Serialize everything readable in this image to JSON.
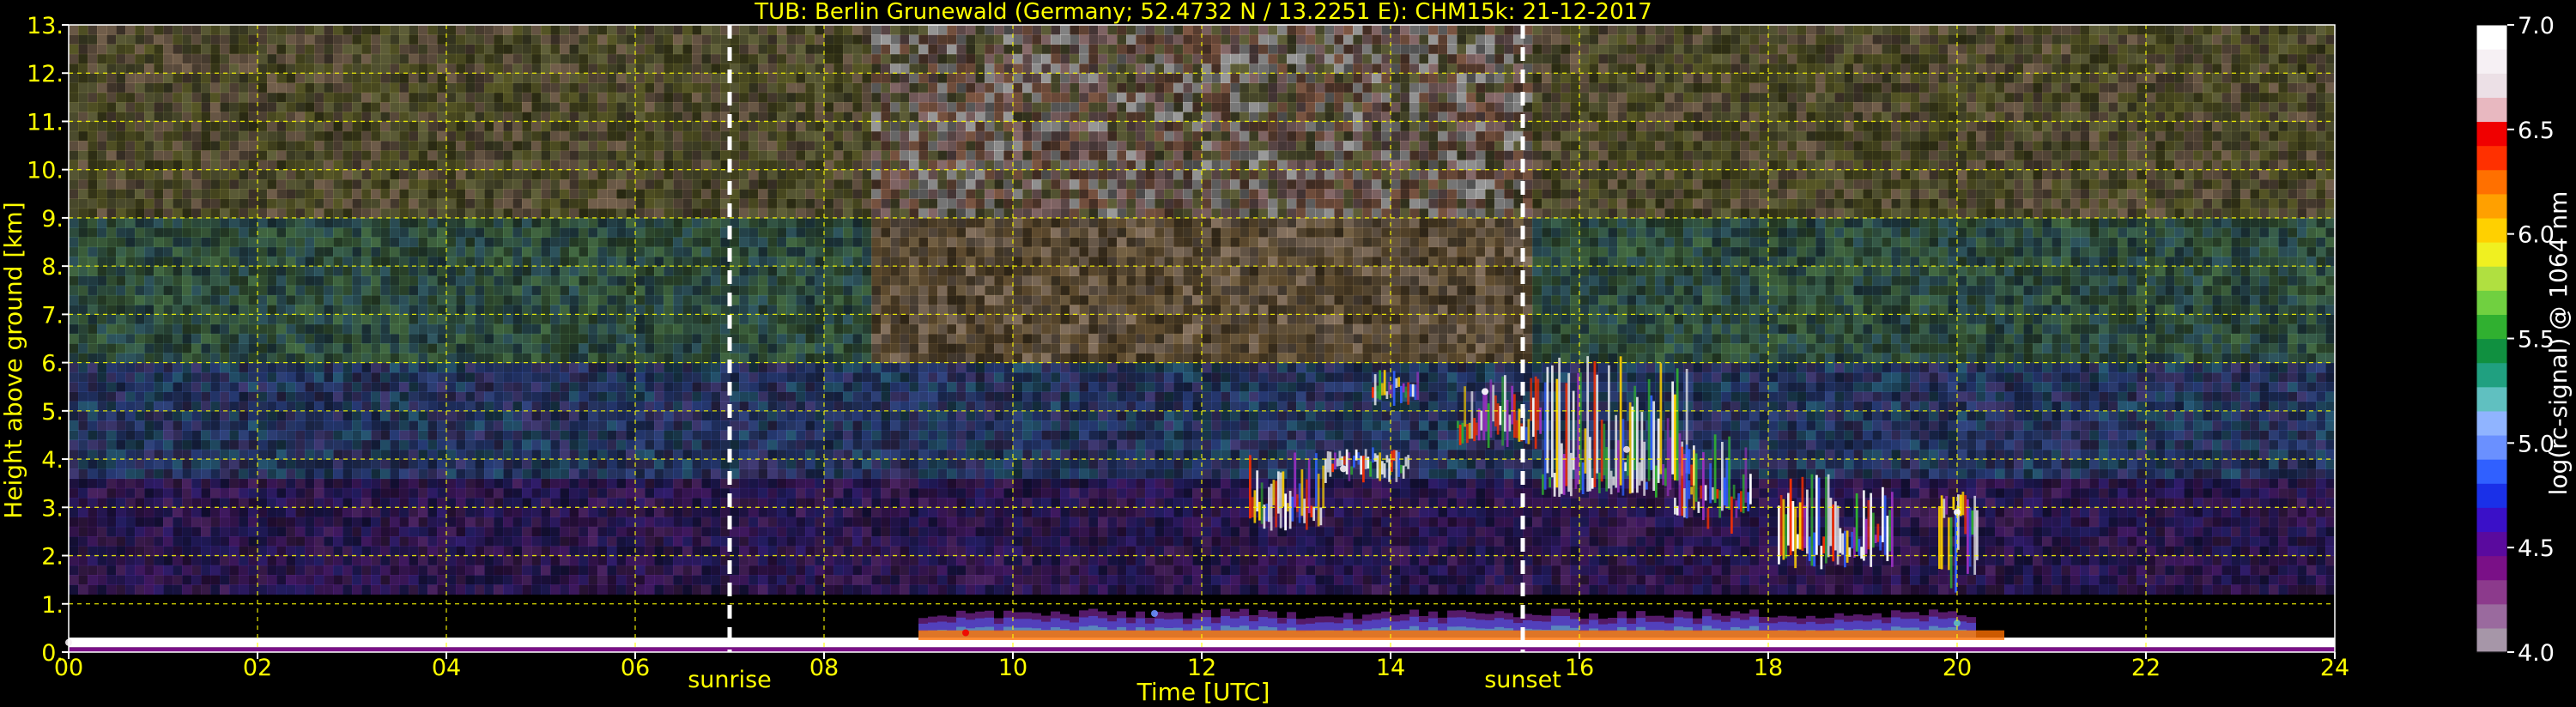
{
  "chart_data": {
    "type": "heatmap",
    "title": "TUB: Berlin Grunewald (Germany; 52.4732 N / 13.2251 E):    CHM15k: 21-12-2017",
    "xlabel": "Time [UTC]",
    "ylabel": "Height above ground [km]",
    "xlim": [
      0,
      24
    ],
    "ylim": [
      0,
      13
    ],
    "x_ticks": [
      "00",
      "02",
      "04",
      "06",
      "08",
      "10",
      "12",
      "14",
      "16",
      "18",
      "20",
      "22",
      "24"
    ],
    "y_ticks": [
      "0.",
      "1.",
      "2.",
      "3.",
      "4.",
      "5.",
      "6.",
      "7.",
      "8.",
      "9.",
      "10.",
      "11.",
      "12.",
      "13."
    ],
    "grid": true,
    "colorbar": {
      "label": "log(rc-signal) @ 1064 nm",
      "range": [
        4.0,
        7.0
      ],
      "tick_labels": [
        "4.0",
        "4.5",
        "5.0",
        "5.5",
        "6.0",
        "6.5",
        "7.0"
      ],
      "colors": [
        "#a696a8",
        "#9a6a9e",
        "#8c3a8c",
        "#7a1087",
        "#5a0a9e",
        "#3a10c8",
        "#1a30e8",
        "#3060ff",
        "#6a90ff",
        "#90b4ff",
        "#60c0c0",
        "#20a080",
        "#109040",
        "#30b030",
        "#70d040",
        "#b0e040",
        "#f0f020",
        "#ffd000",
        "#ffa000",
        "#ff7000",
        "#ff3000",
        "#f00000",
        "#e8b8c0",
        "#ece0e6",
        "#f6f0f4",
        "#ffffff"
      ]
    },
    "annotations": [
      {
        "x": 7.0,
        "label": "sunrise"
      },
      {
        "x": 15.4,
        "label": "sunset"
      }
    ],
    "features": {
      "surface_layer": {
        "x": [
          0,
          24
        ],
        "height_km": [
          0.1,
          0.3
        ],
        "level": "high"
      },
      "boundary_layer_aerosol": {
        "x": [
          9.0,
          20.2
        ],
        "height_km": [
          0.2,
          1.0
        ]
      },
      "clouds": [
        {
          "x": [
            12.5,
            13.3
          ],
          "height_km": [
            2.3,
            4.2
          ],
          "base_km": 2.8
        },
        {
          "x": [
            13.3,
            14.2
          ],
          "height_km": [
            3.6,
            4.2
          ],
          "base_km": 3.8
        },
        {
          "x": [
            13.8,
            14.3
          ],
          "height_km": [
            5.0,
            5.7
          ],
          "base_km": 5.5
        },
        {
          "x": [
            14.7,
            15.6
          ],
          "height_km": [
            3.7,
            5.8
          ],
          "base_km": 4.5
        },
        {
          "x": [
            15.6,
            17.2
          ],
          "height_km": [
            1.8,
            6.2
          ],
          "base_km": 3.5
        },
        {
          "x": [
            17.0,
            17.8
          ],
          "height_km": [
            1.5,
            4.6
          ],
          "base_km": 3.0
        },
        {
          "x": [
            18.1,
            19.3
          ],
          "height_km": [
            1.3,
            3.7
          ],
          "base_km": 2.0
        },
        {
          "x": [
            19.8,
            20.2
          ],
          "height_km": [
            0.4,
            3.2
          ],
          "base_km": 2.9
        }
      ],
      "dense_cloud_base_km": 3.0
    },
    "points": [
      {
        "x": 0.0,
        "height_km": 0.2,
        "level": 6.8
      },
      {
        "x": 9.5,
        "height_km": 0.4,
        "level": 6.5
      },
      {
        "x": 11.5,
        "height_km": 0.8,
        "level": 5.0
      },
      {
        "x": 13.5,
        "height_km": 3.8,
        "level": 6.8
      },
      {
        "x": 15.0,
        "height_km": 5.4,
        "level": 6.9
      },
      {
        "x": 16.5,
        "height_km": 4.2,
        "level": 6.7
      },
      {
        "x": 20.0,
        "height_km": 2.9,
        "level": 6.9
      },
      {
        "x": 20.0,
        "height_km": 0.6,
        "level": 5.2
      }
    ]
  }
}
